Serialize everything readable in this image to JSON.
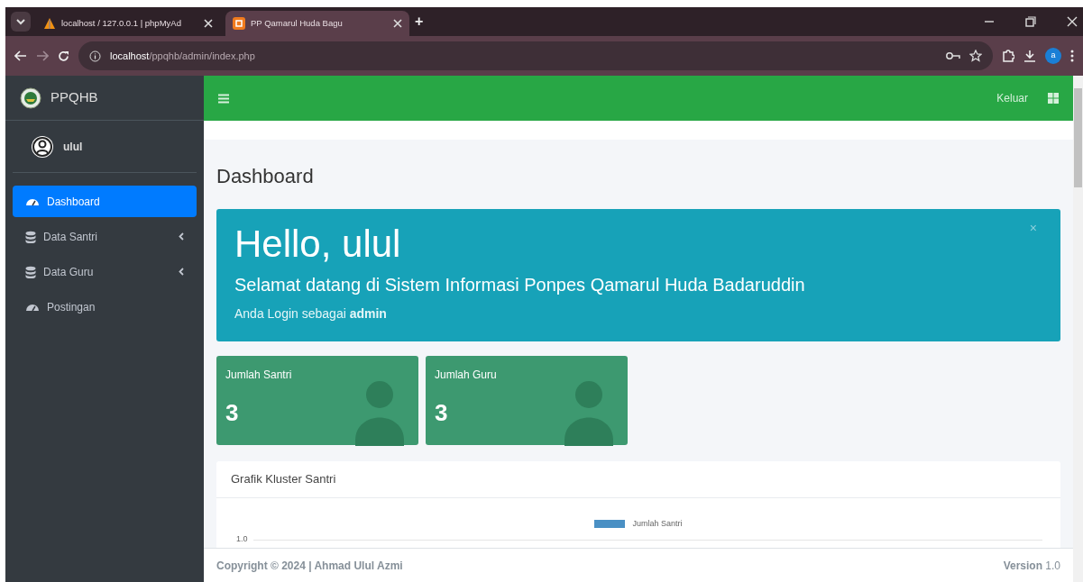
{
  "browser": {
    "tabs": [
      {
        "title": "localhost / 127.0.0.1 | phpMyAd",
        "selected": false
      },
      {
        "title": "PP Qamarul Huda Bagu",
        "selected": true
      }
    ],
    "new_tab": "+",
    "url_host": "localhost",
    "url_path": "/ppqhb/admin/index.php",
    "profile": "a"
  },
  "sidebar": {
    "brand": "PPQHB",
    "user": "ulul",
    "items": [
      {
        "label": "Dashboard",
        "selected": true,
        "has_submenu": false
      },
      {
        "label": "Data Santri",
        "selected": false,
        "has_submenu": true
      },
      {
        "label": "Data Guru",
        "selected": false,
        "has_submenu": true
      },
      {
        "label": "Postingan",
        "selected": false,
        "has_submenu": false
      }
    ]
  },
  "navbar": {
    "logout": "Keluar"
  },
  "page_title": "Dashboard",
  "alert": {
    "greeting": "Hello, **ulul**",
    "subtitle": "Selamat datang di Sistem Informasi Ponpes Qamarul Huda Badaruddin",
    "role_line": "Anda Login sebagai **admin**",
    "close": "×"
  },
  "stat_boxes": [
    {
      "label": "Jumlah Santri",
      "value": "3"
    },
    {
      "label": "Jumlah Guru",
      "value": "3"
    }
  ],
  "chart_card": {
    "title": "Grafik Kluster Santri",
    "legend": [
      {
        "label": "Jumlah Santri",
        "color": "#4a90c4"
      }
    ],
    "y_tick": "1.0"
  },
  "footer": {
    "copyright": "Copyright © 2024 | Ahmad Ulul Azmi",
    "version": "**Version** 1.0"
  }
}
